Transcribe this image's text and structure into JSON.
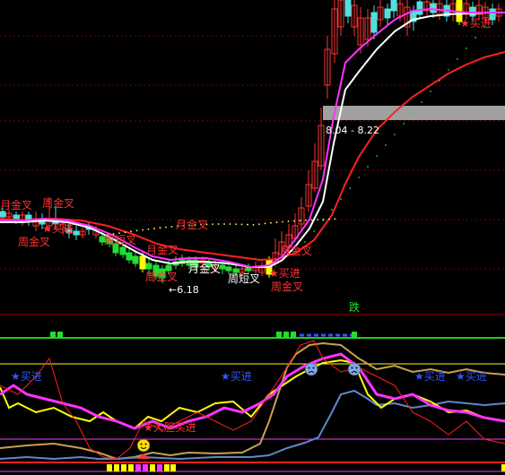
{
  "colors": {
    "background": "#000000",
    "grid": "#7a0000",
    "candle_up": "#ff3333",
    "candle_down": "#4fe0e0",
    "candle_green": "#22dd33",
    "ma_white": "#ffffff",
    "ma_magenta": "#ff33ff",
    "ma_red": "#ff2020",
    "signal_text": "#ff3333",
    "buy_text": "#3355ff",
    "yellow": "#ffff00",
    "green_line": "#22cc22",
    "olive": "#c8a050",
    "steelblue": "#5f88c8",
    "highlight_band": "#a0a0a0"
  },
  "main_panel": {
    "range_label": "8.04 - 8.22",
    "low_label": "←6.18",
    "signals": [
      {
        "text": "月金叉",
        "anchor": "left-top"
      },
      {
        "text": "周金叉",
        "anchor": "left-mid-a"
      },
      {
        "text": "周金叉",
        "anchor": "left-mid-b"
      },
      {
        "text": "★买进",
        "anchor": "left-buy"
      },
      {
        "text": "周短叉",
        "anchor": "center-left"
      },
      {
        "text": "月金叉",
        "anchor": "center-a"
      },
      {
        "text": "月金叉",
        "anchor": "center-b"
      },
      {
        "text": "周金叉",
        "anchor": "center-c"
      },
      {
        "text": "月金叉",
        "anchor": "center-d"
      },
      {
        "text": "周短叉",
        "anchor": "center-e"
      },
      {
        "text": "月金叉",
        "anchor": "center-f"
      },
      {
        "text": "★买进",
        "anchor": "center-buy"
      },
      {
        "text": "周金叉",
        "anchor": "center-g"
      },
      {
        "text": "★买进",
        "anchor": "top-right-buy"
      }
    ]
  },
  "separator_label": "跌",
  "indicator_panel": {
    "buy_labels": [
      "★买进",
      "★买进",
      "★买进",
      "★买进"
    ],
    "bold_buy_label": "★大胆买进"
  },
  "chart_data": {
    "type": "candlestick",
    "title": "",
    "annotations": [
      "8.04 - 8.22",
      "←6.18",
      "跌",
      "★大胆买进",
      "★买进",
      "月金叉",
      "周金叉",
      "周短叉"
    ],
    "series": [
      {
        "values": []
      }
    ]
  }
}
